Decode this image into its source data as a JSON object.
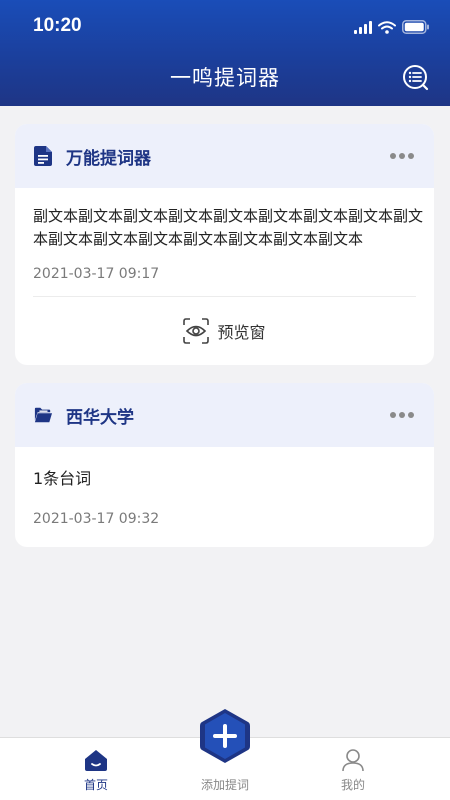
{
  "status_bar": {
    "time": "10:20"
  },
  "header": {
    "title": "一鸣提词器"
  },
  "cards": [
    {
      "title": "万能提词器",
      "body": "副文本副文本副文本副文本副文本副文本副文本副文本副文本副文本副文本副文本副文本副文本副文本副文本",
      "date": "2021-03-17 09:17",
      "action_label": "预览窗"
    },
    {
      "title": "西华大学",
      "body": "1条台词",
      "date": "2021-03-17 09:32"
    }
  ],
  "nav": {
    "home_label": "首页",
    "add_label": "添加提词",
    "mine_label": "我的"
  },
  "colors": {
    "header": "#1b3f9c",
    "accent": "#1e3585",
    "card_head_bg": "#edf0fb",
    "page_bg": "#f2f2f4"
  },
  "icons": [
    "signal-icon",
    "wifi-icon",
    "battery-icon",
    "list-menu-icon",
    "document-icon",
    "folder-icon",
    "more-icon",
    "eye-icon",
    "home-icon",
    "plus-icon",
    "user-icon"
  ]
}
